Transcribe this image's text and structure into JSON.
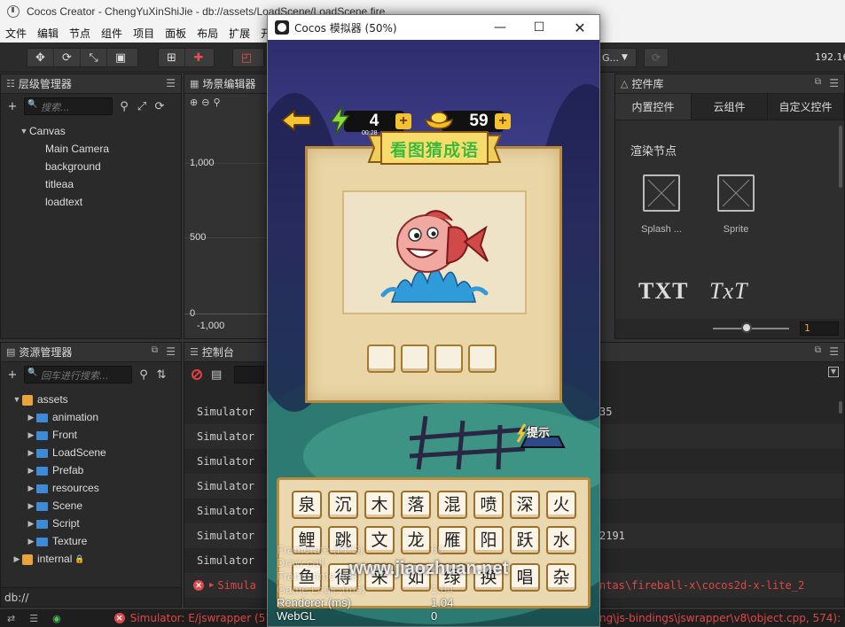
{
  "window": {
    "title": "Cocos Creator - ChengYuXinShiJie - db://assets/LoadScene/LoadScene.fire"
  },
  "menu": [
    "文件",
    "编辑",
    "节点",
    "组件",
    "项目",
    "面板",
    "布局",
    "扩展",
    "开"
  ],
  "toolbar": {
    "platform": "G...",
    "ip": "192.16"
  },
  "hierarchy": {
    "title": "层级管理器",
    "search_placeholder": "搜索...",
    "nodes": [
      {
        "label": "Canvas",
        "expanded": true,
        "depth": 0
      },
      {
        "label": "Main Camera",
        "depth": 1
      },
      {
        "label": "background",
        "depth": 1
      },
      {
        "label": "titleaa",
        "depth": 1
      },
      {
        "label": "loadtext",
        "depth": 1
      }
    ]
  },
  "scene": {
    "title": "场景编辑器",
    "axis_labels": [
      "1,000",
      "500",
      "0",
      "-1,000"
    ]
  },
  "library": {
    "title": "控件库",
    "tabs": [
      "内置控件",
      "云组件",
      "自定义控件"
    ],
    "section": "渲染节点",
    "items": [
      "Splash ...",
      "Sprite"
    ],
    "text_items": [
      "TXT",
      "TxT"
    ],
    "slider_value": "1"
  },
  "assets": {
    "title": "资源管理器",
    "search_placeholder": "回车进行搜索...",
    "root": "assets",
    "folders": [
      "animation",
      "Front",
      "LoadScene",
      "Prefab",
      "resources",
      "Scene",
      "Script",
      "Texture"
    ],
    "internal": "internal",
    "path": "db://"
  },
  "console": {
    "title": "控制台",
    "rows": [
      {
        "text": "Simulator",
        "tail": "35"
      },
      {
        "text": "Simulator",
        "tail": ""
      },
      {
        "text": "Simulator",
        "tail": ""
      },
      {
        "text": "Simulator",
        "tail": ""
      },
      {
        "text": "Simulator",
        "tail": ""
      },
      {
        "text": "Simulator",
        "tail": "2191"
      },
      {
        "text": "Simulator",
        "tail": ""
      }
    ],
    "error_row": {
      "prefix": "Simula",
      "tail": "ntas\\fireball-x\\cocos2d-x-lite_2"
    }
  },
  "status": {
    "left": "Simulator: E/jswrapper (574",
    "right": "ng\\js-bindings\\jswrapper\\v8\\object.cpp, 574): Invoking"
  },
  "simulator": {
    "title": "Cocos 模拟器 (50%)",
    "energy": "4",
    "timer": "00:28",
    "coins": "59",
    "banner": "看图猜成语",
    "hint": "提示",
    "answer_slots": 4,
    "chars": [
      [
        "泉",
        "沉",
        "木",
        "落",
        "混",
        "喷",
        "深",
        "火"
      ],
      [
        "鲤",
        "跳",
        "文",
        "龙",
        "雁",
        "阳",
        "跃",
        "水"
      ],
      [
        "鱼",
        "得",
        "来",
        "如",
        "绿",
        "换",
        "唱",
        "杂"
      ]
    ],
    "watermark": "www.jiaozhuan.net",
    "stats": [
      {
        "label": "Framerate (FPS)",
        "value": "60",
        "faint": true
      },
      {
        "label": "Draw call",
        "value": "",
        "faint": true
      },
      {
        "label": "Frame time (ms)",
        "value": "",
        "faint": true
      },
      {
        "label": "Game Logic (ms)",
        "value": "1.04",
        "faint": true
      },
      {
        "label": "Renderer (ms)",
        "value": "1.04",
        "faint": false
      },
      {
        "label": "WebGL",
        "value": "0",
        "faint": false
      }
    ]
  }
}
